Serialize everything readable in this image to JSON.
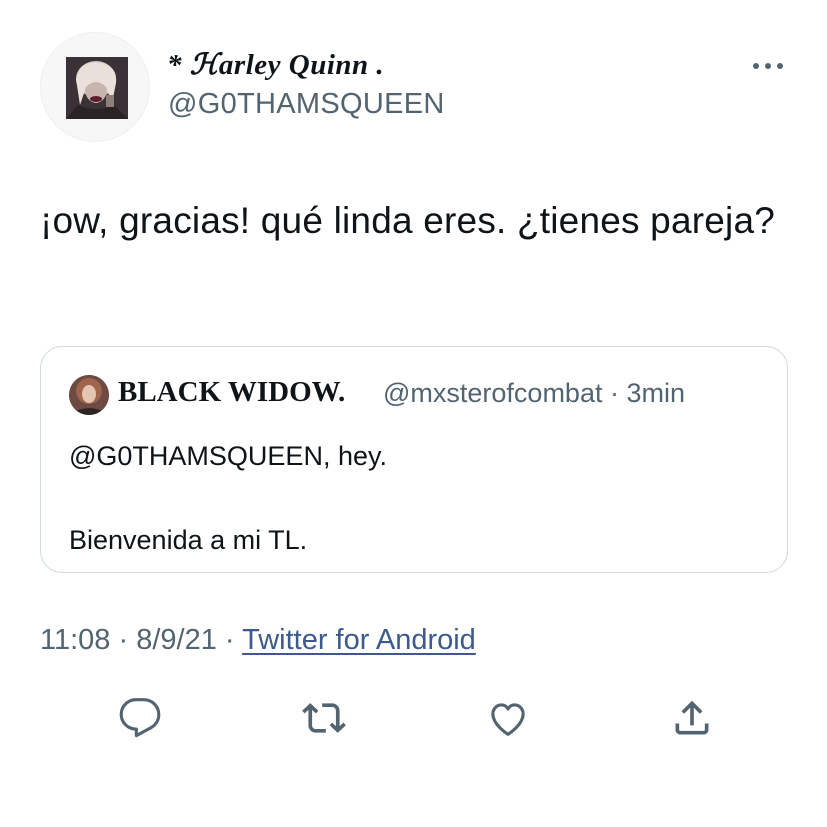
{
  "author": {
    "display_name": "* ℋarley Quinn .",
    "handle": "@G0THAMSQUEEN"
  },
  "tweet": {
    "text": "¡ow, gracias! qué linda eres. ¿tienes pareja?"
  },
  "quoted": {
    "display_name": "BLACK WIDOW.",
    "meta": "@mxsterofcombat · 3min",
    "line1": "@G0THAMSQUEEN, hey.",
    "line2": "Bienvenida a mi TL."
  },
  "meta": {
    "time": "11:08",
    "separator": " · ",
    "date": "8/9/21",
    "source": "Twitter for Android"
  },
  "actions": {
    "reply_icon": "reply-icon",
    "retweet_icon": "retweet-icon",
    "like_icon": "like-icon",
    "share_icon": "share-icon"
  },
  "colors": {
    "text": "#0f1419",
    "secondary": "#536471",
    "link": "#3c5a8c",
    "border": "#cfd9de"
  }
}
